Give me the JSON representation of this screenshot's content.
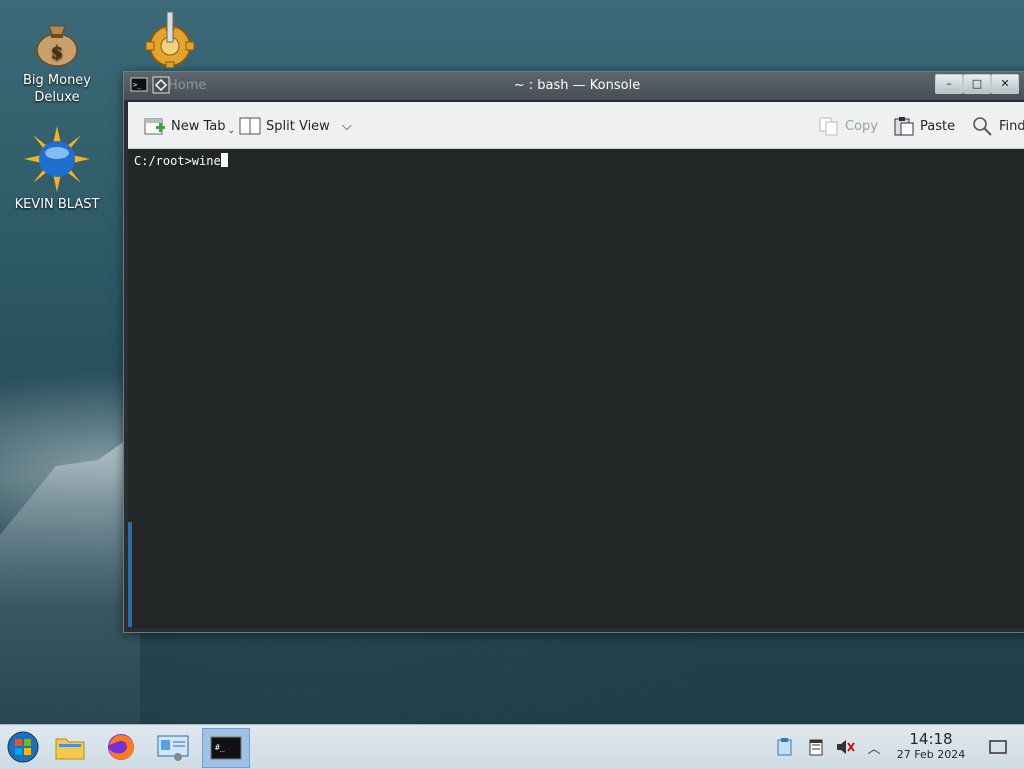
{
  "desktop": {
    "icons": [
      {
        "label_line1": "Big Money",
        "label_line2": "Deluxe",
        "icon": "money-bag-icon"
      },
      {
        "label_line1": "",
        "label_line2": "",
        "icon": "gear-icon"
      },
      {
        "label_line1": "KEVIN BLAST",
        "label_line2": "",
        "icon": "sun-globe-icon"
      }
    ]
  },
  "window": {
    "title": "~ : bash — Konsole",
    "ghost_title": "Home",
    "buttons": {
      "minimize": "–",
      "maximize": "□",
      "close": "✕"
    }
  },
  "toolbar": {
    "new_tab": "New Tab",
    "split_view": "Split View",
    "copy": "Copy",
    "paste": "Paste",
    "find": "Find"
  },
  "terminal": {
    "prompt": "C:/root>",
    "input": "wine"
  },
  "taskbar": {
    "apps": [
      "start-orb-icon",
      "folder-icon",
      "firefox-icon",
      "system-settings-icon",
      "terminal-icon"
    ],
    "clock_time": "14:18",
    "clock_date": "27 Feb 2024"
  },
  "colors": {
    "terminal_bg": "#232627",
    "toolbar_bg": "#eef0f2",
    "taskbar_active": "#9ec3e6"
  }
}
